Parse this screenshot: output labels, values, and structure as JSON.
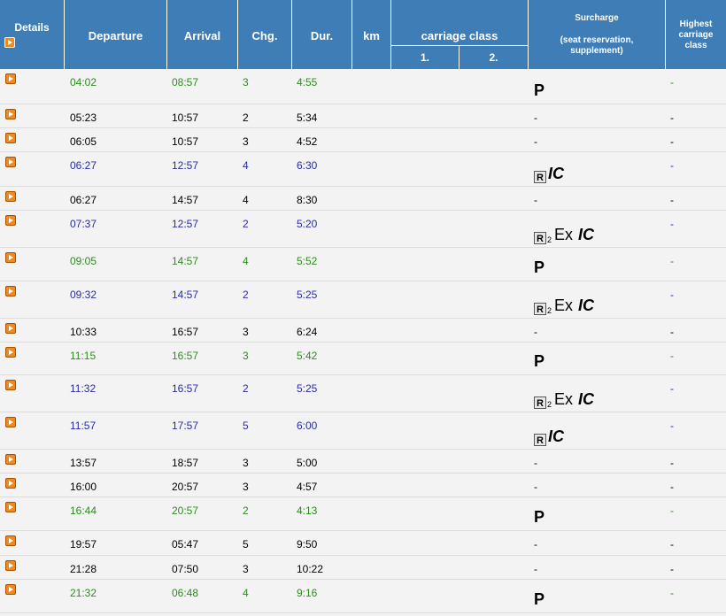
{
  "header": {
    "details": "Details",
    "departure": "Departure",
    "arrival": "Arrival",
    "changes": "Chg.",
    "duration": "Dur.",
    "km": "km",
    "carriage_class": "carriage class",
    "class_1": "1.",
    "class_2": "2.",
    "surcharge_title": "Surcharge",
    "surcharge_sub": "(seat reservation, supplement)",
    "highest_class": "Highest carriage class"
  },
  "colors": {
    "header_bg": "#3f7db6",
    "green": "#2e8b1f",
    "blue": "#2b2ba0",
    "black": "#000000",
    "arrow": "#f08a1c"
  },
  "icons": [
    "details-arrow-icon",
    "reservation-r-icon",
    "ic-train-icon"
  ],
  "rows": [
    {
      "dep": "04:02",
      "arr": "08:57",
      "chg": "3",
      "dur": "4:55",
      "surcharge": "P",
      "sur_type": "p",
      "high": "-",
      "color": "green"
    },
    {
      "dep": "05:23",
      "arr": "10:57",
      "chg": "2",
      "dur": "5:34",
      "surcharge": "-",
      "sur_type": "dash",
      "high": "-",
      "color": "black"
    },
    {
      "dep": "06:05",
      "arr": "10:57",
      "chg": "3",
      "dur": "4:52",
      "surcharge": "-",
      "sur_type": "dash",
      "high": "-",
      "color": "black"
    },
    {
      "dep": "06:27",
      "arr": "12:57",
      "chg": "4",
      "dur": "6:30",
      "surcharge": "R IC",
      "sur_type": "ric",
      "high": "-",
      "color": "blue"
    },
    {
      "dep": "06:27",
      "arr": "14:57",
      "chg": "4",
      "dur": "8:30",
      "surcharge": "-",
      "sur_type": "dash",
      "high": "-",
      "color": "black"
    },
    {
      "dep": "07:37",
      "arr": "12:57",
      "chg": "2",
      "dur": "5:20",
      "surcharge": "R2 Ex IC",
      "sur_type": "rexic",
      "high": "-",
      "color": "blue"
    },
    {
      "dep": "09:05",
      "arr": "14:57",
      "chg": "4",
      "dur": "5:52",
      "surcharge": "P",
      "sur_type": "p",
      "high": "-",
      "color": "green"
    },
    {
      "dep": "09:32",
      "arr": "14:57",
      "chg": "2",
      "dur": "5:25",
      "surcharge": "R2 Ex IC",
      "sur_type": "rexic",
      "high": "-",
      "color": "blue"
    },
    {
      "dep": "10:33",
      "arr": "16:57",
      "chg": "3",
      "dur": "6:24",
      "surcharge": "-",
      "sur_type": "dash",
      "high": "-",
      "color": "black"
    },
    {
      "dep": "11:15",
      "arr": "16:57",
      "chg": "3",
      "dur": "5:42",
      "surcharge": "P",
      "sur_type": "p",
      "high": "-",
      "color": "green"
    },
    {
      "dep": "11:32",
      "arr": "16:57",
      "chg": "2",
      "dur": "5:25",
      "surcharge": "R2 Ex IC",
      "sur_type": "rexic",
      "high": "-",
      "color": "blue"
    },
    {
      "dep": "11:57",
      "arr": "17:57",
      "chg": "5",
      "dur": "6:00",
      "surcharge": "R IC",
      "sur_type": "ric",
      "high": "-",
      "color": "blue"
    },
    {
      "dep": "13:57",
      "arr": "18:57",
      "chg": "3",
      "dur": "5:00",
      "surcharge": "-",
      "sur_type": "dash",
      "high": "-",
      "color": "black"
    },
    {
      "dep": "16:00",
      "arr": "20:57",
      "chg": "3",
      "dur": "4:57",
      "surcharge": "-",
      "sur_type": "dash",
      "high": "-",
      "color": "black"
    },
    {
      "dep": "16:44",
      "arr": "20:57",
      "chg": "2",
      "dur": "4:13",
      "surcharge": "P",
      "sur_type": "p",
      "high": "-",
      "color": "green"
    },
    {
      "dep": "19:57",
      "arr": "05:47",
      "chg": "5",
      "dur": "9:50",
      "surcharge": "-",
      "sur_type": "dash",
      "high": "-",
      "color": "black"
    },
    {
      "dep": "21:28",
      "arr": "07:50",
      "chg": "3",
      "dur": "10:22",
      "surcharge": "-",
      "sur_type": "dash",
      "high": "-",
      "color": "black"
    },
    {
      "dep": "21:32",
      "arr": "06:48",
      "chg": "4",
      "dur": "9:16",
      "surcharge": "P",
      "sur_type": "p",
      "high": "-",
      "color": "green"
    }
  ]
}
